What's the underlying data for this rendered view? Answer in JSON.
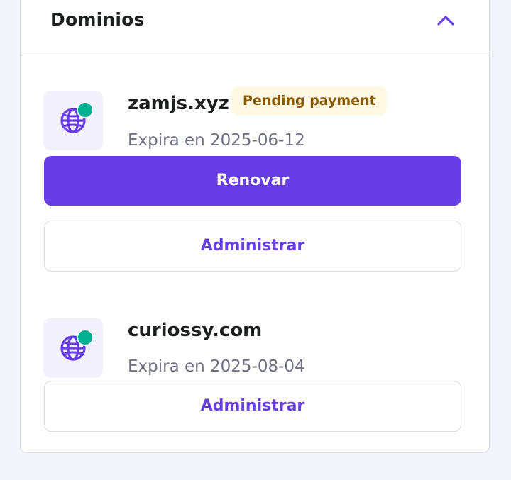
{
  "section": {
    "title": "Dominios",
    "collapse_icon": "chevron-up-icon"
  },
  "colors": {
    "accent": "#673de6",
    "status_active": "#00b090",
    "badge_background": "#fff8e2",
    "badge_text": "#8a5a00",
    "page_background": "#f4f4fc"
  },
  "domains": [
    {
      "icon": "globe-icon",
      "name": "zamjs.xyz",
      "badge": "Pending payment",
      "expiry": "Expira en 2025-06-12",
      "renew_label": "Renovar",
      "manage_label": "Administrar"
    },
    {
      "icon": "globe-icon",
      "name": "curiossy.com",
      "expiry": "Expira en 2025-08-04",
      "manage_label": "Administrar"
    }
  ]
}
